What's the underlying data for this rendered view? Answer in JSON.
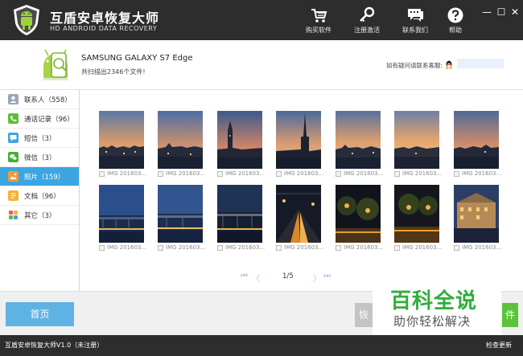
{
  "app": {
    "title": "互盾安卓恢复大师",
    "subtitle": "HD ANDROID DATA RECOVERY"
  },
  "toolbar": {
    "buy_label": "购买软件",
    "register_label": "注册激活",
    "contact_label": "联系我们",
    "help_label": "帮助"
  },
  "window_controls": {
    "minimize": "—",
    "maximize": "☐",
    "close": "✕"
  },
  "device": {
    "name": "SAMSUNG  GALAXY S7 Edge",
    "scan_result": "共扫描出2346个文件!",
    "support_text": "如有疑问请联系客服:"
  },
  "sidebar": {
    "items": [
      {
        "label": "联系人（558）",
        "icon": "contacts-icon",
        "color": "#9aa6b4"
      },
      {
        "label": "通话记录（96）",
        "icon": "phone-icon",
        "color": "#5cbf3a"
      },
      {
        "label": "短信（3）",
        "icon": "sms-icon",
        "color": "#3fa4e0"
      },
      {
        "label": "微信（3）",
        "icon": "wechat-icon",
        "color": "#44b034"
      },
      {
        "label": "照片（159）",
        "icon": "photo-icon",
        "color": "#f09a3a"
      },
      {
        "label": "文档（96）",
        "icon": "document-icon",
        "color": "#f2b33a"
      },
      {
        "label": "其它（3）",
        "icon": "other-icon",
        "color": "#e85f5f"
      }
    ],
    "active_index": 4
  },
  "photos": {
    "caption": "IMG 201603...",
    "row1": [
      "city-dusk",
      "city-dusk",
      "tower",
      "spire",
      "city-dusk",
      "city-sunset",
      "city-dusk"
    ],
    "row2": [
      "bridge-blue",
      "bridge-blue",
      "bridge-dark",
      "night-street",
      "night-trees",
      "night-trees",
      "building-night"
    ]
  },
  "pagination": {
    "first": "⏮",
    "prev": "〈",
    "page": "1/5",
    "next": "〉",
    "last": "⏭"
  },
  "actions": {
    "home_label": "首页",
    "recover_label": "恢",
    "export_label": "件"
  },
  "watermark": {
    "title": "百科全说",
    "subtitle": "助你轻松解决"
  },
  "status": {
    "left": "互盾安卓恢复大师V1.0（未注册）",
    "right": "检查更新"
  },
  "colors": {
    "header_bg": "#2d2d2d",
    "accent_blue": "#3ba6e0",
    "accent_green": "#5cc23c"
  }
}
